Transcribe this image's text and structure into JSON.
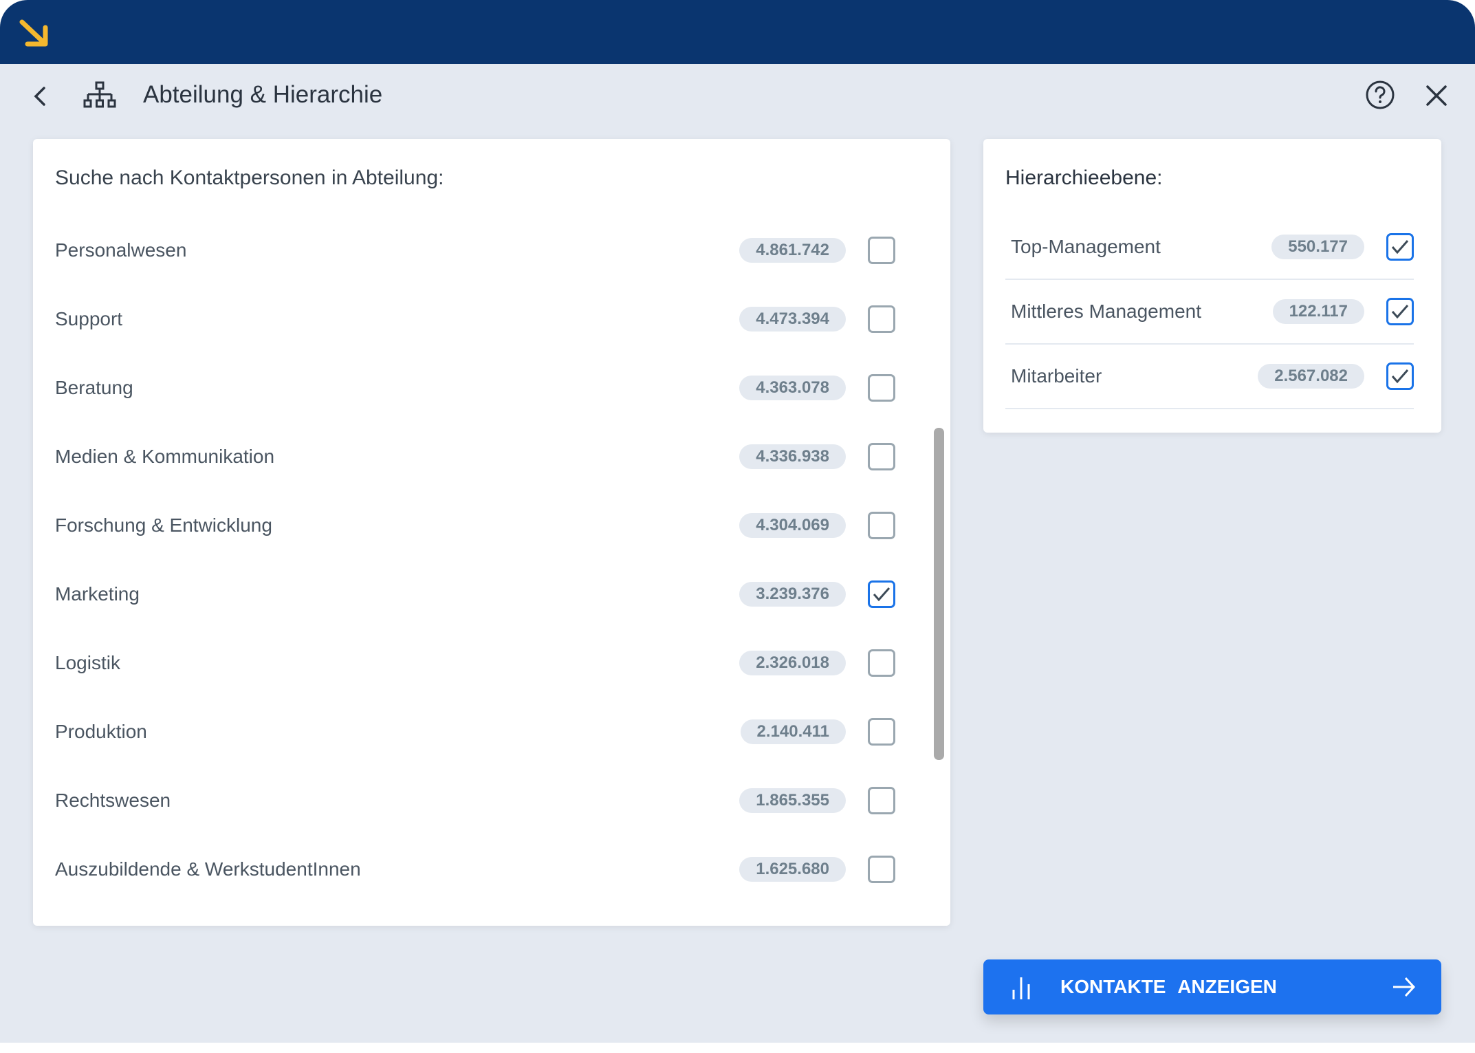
{
  "header": {
    "title": "Abteilung & Hierarchie"
  },
  "departments": {
    "heading": "Suche nach Kontaktpersonen in Abteilung:",
    "items": [
      {
        "label": "Personalwesen",
        "count": "4.861.742",
        "checked": false
      },
      {
        "label": "Support",
        "count": "4.473.394",
        "checked": false
      },
      {
        "label": "Beratung",
        "count": "4.363.078",
        "checked": false
      },
      {
        "label": "Medien & Kommunikation",
        "count": "4.336.938",
        "checked": false
      },
      {
        "label": "Forschung & Entwicklung",
        "count": "4.304.069",
        "checked": false
      },
      {
        "label": "Marketing",
        "count": "3.239.376",
        "checked": true
      },
      {
        "label": "Logistik",
        "count": "2.326.018",
        "checked": false
      },
      {
        "label": "Produktion",
        "count": "2.140.411",
        "checked": false
      },
      {
        "label": "Rechtswesen",
        "count": "1.865.355",
        "checked": false
      },
      {
        "label": "Auszubildende & WerkstudentInnen",
        "count": "1.625.680",
        "checked": false
      }
    ]
  },
  "hierarchy": {
    "heading": "Hierarchieebene:",
    "items": [
      {
        "label": "Top-Management",
        "count": "550.177",
        "checked": true
      },
      {
        "label": "Mittleres Management",
        "count": "122.117",
        "checked": true
      },
      {
        "label": "Mitarbeiter",
        "count": "2.567.082",
        "checked": true
      }
    ]
  },
  "cta": {
    "label": "KONTAKTE ANZEIGEN"
  },
  "colors": {
    "header": "#0a356f",
    "accent": "#1d72ef",
    "logo": "#f5b82e"
  }
}
